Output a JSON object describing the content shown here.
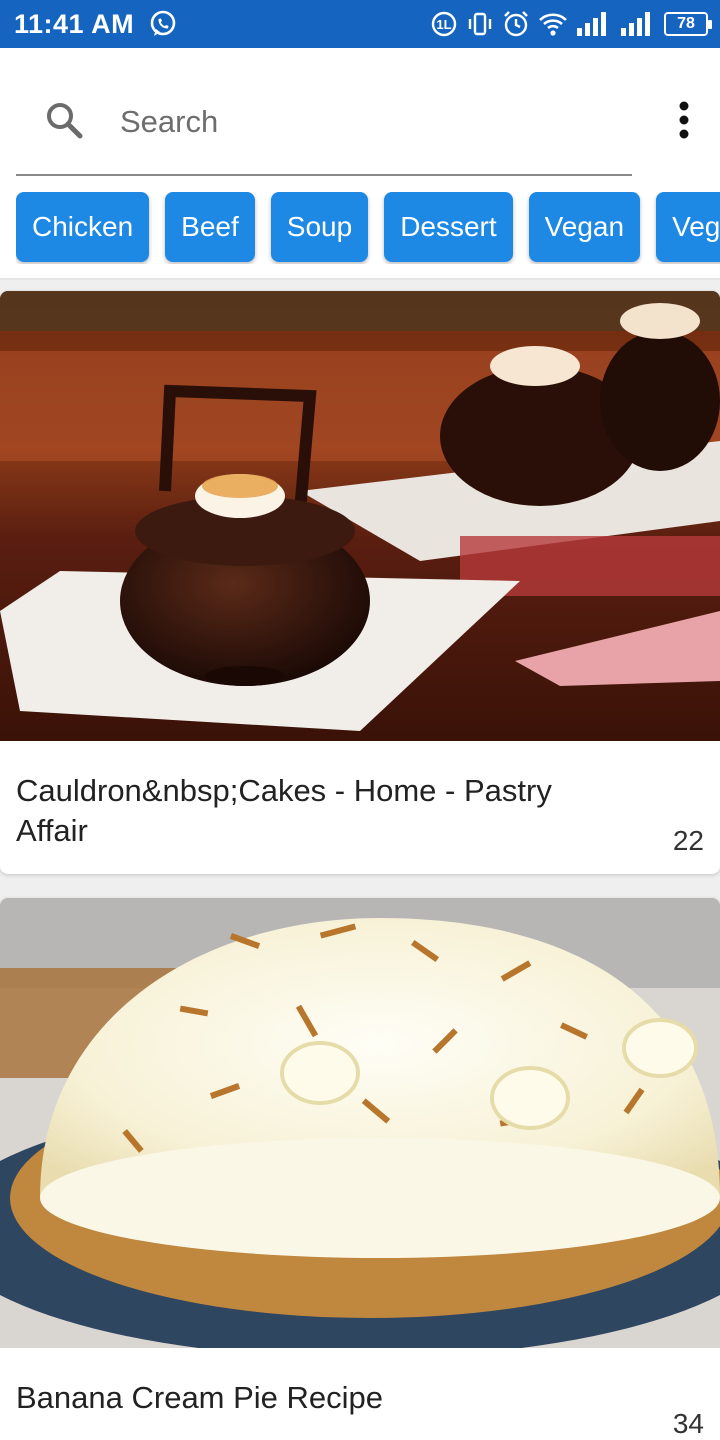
{
  "status_bar": {
    "time": "11:41 AM",
    "battery": "78",
    "icons": [
      "whatsapp-icon",
      "data-saver-icon",
      "vibrate-icon",
      "alarm-icon",
      "wifi-icon",
      "signal-icon",
      "signal-icon",
      "battery-icon"
    ]
  },
  "search": {
    "placeholder": "Search",
    "value": ""
  },
  "categories": [
    "Chicken",
    "Beef",
    "Soup",
    "Dessert",
    "Vegan",
    "Vegetarian"
  ],
  "recipes": [
    {
      "title": "Cauldron&nbsp;Cakes - Home - Pastry Affair",
      "count": "22",
      "image": "chocolate-cauldron-cake-photo"
    },
    {
      "title": "Banana Cream Pie Recipe",
      "count": "34",
      "image": "banana-cream-pie-photo"
    }
  ],
  "colors": {
    "status_bar": "#1565c0",
    "chip": "#1e88e5",
    "background": "#efefef"
  }
}
